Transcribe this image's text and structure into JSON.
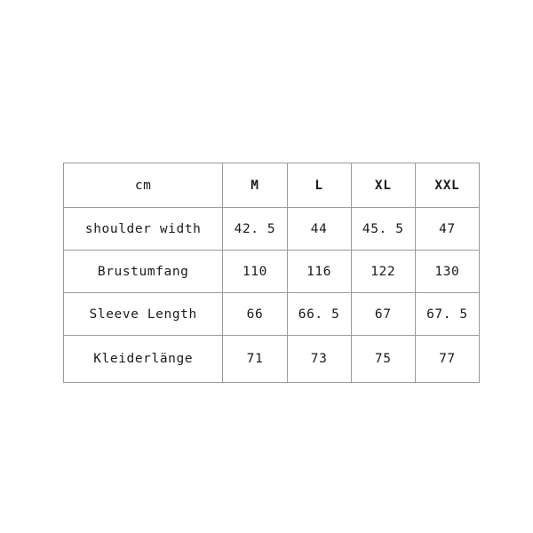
{
  "chart_data": {
    "type": "table",
    "title": "",
    "unit_label": "cm",
    "columns": [
      "cm",
      "M",
      "L",
      "XL",
      "XXL"
    ],
    "categories": [
      "shoulder width",
      "Brustumfang",
      "Sleeve Length",
      "Kleiderlänge"
    ],
    "series": [
      {
        "name": "M",
        "values": [
          "42. 5",
          "110",
          "66",
          "71"
        ]
      },
      {
        "name": "L",
        "values": [
          "44",
          "116",
          "66. 5",
          "73"
        ]
      },
      {
        "name": "XL",
        "values": [
          "45. 5",
          "122",
          "67",
          "75"
        ]
      },
      {
        "name": "XXL",
        "values": [
          "47",
          "130",
          "67. 5",
          "77"
        ]
      }
    ],
    "rows": [
      {
        "label": "shoulder width",
        "values": [
          "42. 5",
          "44",
          "45. 5",
          "47"
        ]
      },
      {
        "label": "Brustumfang",
        "values": [
          "110",
          "116",
          "122",
          "130"
        ]
      },
      {
        "label": "Sleeve Length",
        "values": [
          "66",
          "66. 5",
          "67",
          "67. 5"
        ]
      },
      {
        "label": "Kleiderlänge",
        "values": [
          "71",
          "73",
          "75",
          "77"
        ]
      }
    ],
    "grid": true,
    "legend_position": "none"
  },
  "table": {
    "header": {
      "unit": "cm",
      "sizes": [
        "M",
        "L",
        "XL",
        "XXL"
      ]
    },
    "rows": [
      {
        "label": "shoulder width",
        "m": "42. 5",
        "l": "44",
        "xl": "45. 5",
        "xxl": "47"
      },
      {
        "label": "Brustumfang",
        "m": "110",
        "l": "116",
        "xl": "122",
        "xxl": "130"
      },
      {
        "label": "Sleeve Length",
        "m": "66",
        "l": "66. 5",
        "xl": "67",
        "xxl": "67. 5"
      },
      {
        "label": "Kleiderlänge",
        "m": "71",
        "l": "73",
        "xl": "75",
        "xxl": "77"
      }
    ]
  },
  "colors": {
    "background": "#ffffff",
    "border": "#9a9a9a",
    "text": "#1a1a1a"
  }
}
